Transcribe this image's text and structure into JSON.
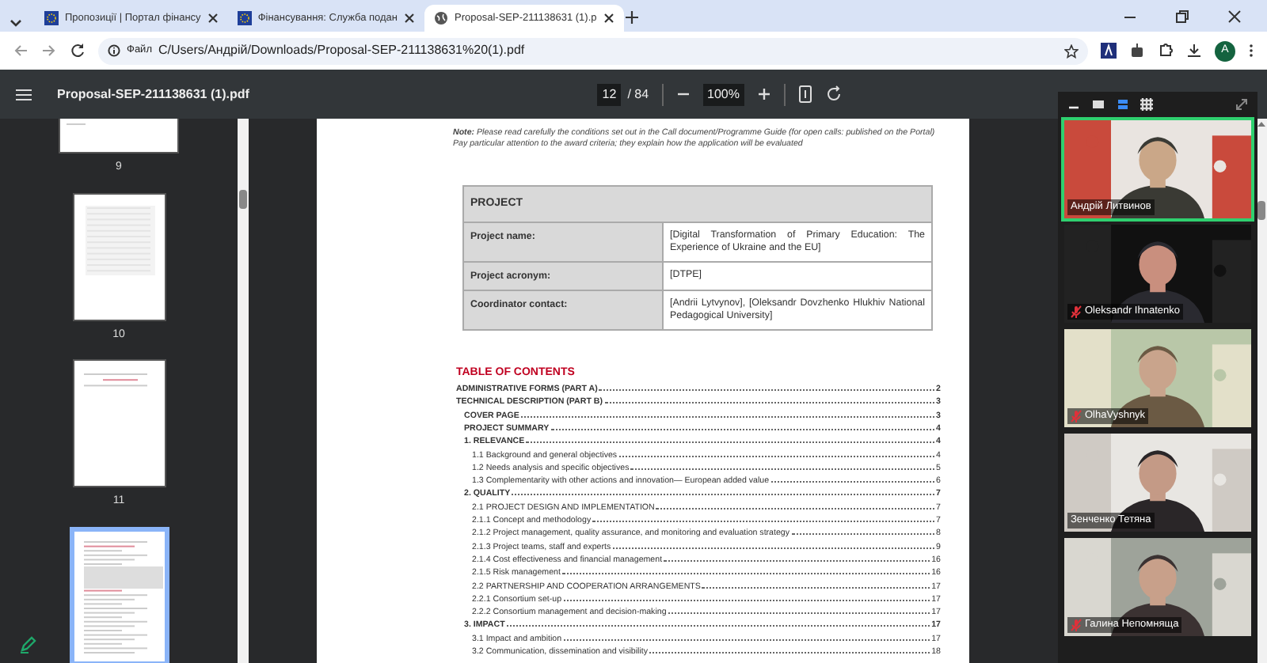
{
  "browser": {
    "tabs": [
      {
        "title": "Пропозиції | Портал фінансу",
        "kind": "eu",
        "selected": false
      },
      {
        "title": "Фінансування: Служба подан",
        "kind": "eu",
        "selected": false
      },
      {
        "title": "Proposal-SEP-211138631 (1).p",
        "kind": "globe",
        "selected": true
      }
    ],
    "address": {
      "chip": "Файл",
      "url": "C/Users/Андрій/Downloads/Proposal-SEP-211138631%20(1).pdf"
    },
    "profile": "A"
  },
  "pdf_toolbar": {
    "title": "Proposal-SEP-211138631 (1).pdf",
    "page": "12",
    "total": "/ 84",
    "zoom": "100%"
  },
  "thumbnails": [
    {
      "label": "9",
      "kind": "partial",
      "selected": false
    },
    {
      "label": "10",
      "kind": "table",
      "selected": false
    },
    {
      "label": "11",
      "kind": "heading",
      "selected": false
    },
    {
      "kind": "toc",
      "selected": true
    }
  ],
  "document": {
    "note": "**Note:** Please read carefully the conditions set out in the Call document/Programme Guide (for open calls: published on the Portal) Pay particular attention to the award criteria; they explain how the application will be evaluated",
    "project_table": {
      "header": "PROJECT",
      "rows": [
        {
          "label": "Project name:",
          "value": "[Digital Transformation of Primary Education: The Experience of Ukraine and the EU]"
        },
        {
          "label": "Project acronym:",
          "value": "[DTPE]"
        },
        {
          "label": "Coordinator contact:",
          "value": "[Andrii Lytvynov], [Oleksandr Dovzhenko Hlukhiv National Pedagogical University]"
        }
      ]
    },
    "toc_title": "TABLE OF CONTENTS",
    "toc": [
      {
        "title": "ADMINISTRATIVE FORMS (PART A)",
        "page": "2"
      },
      {
        "title": "TECHNICAL DESCRIPTION (PART B)",
        "page": "3",
        "children": [
          {
            "title": "COVER PAGE",
            "page": "3"
          },
          {
            "title": "PROJECT SUMMARY",
            "page": "4"
          },
          {
            "title": "1. RELEVANCE",
            "page": "4",
            "children": [
              {
                "title": "1.1 Background and general objectives",
                "page": "4"
              },
              {
                "title": "1.2 Needs analysis and specific objectives",
                "page": "5"
              },
              {
                "title": "1.3 Complementarity with other actions and innovation— European added value",
                "page": "6"
              }
            ]
          },
          {
            "title": "2. QUALITY",
            "page": "7",
            "children": [
              {
                "title": "2.1 PROJECT DESIGN AND IMPLEMENTATION",
                "page": "7"
              },
              {
                "title": "2.1.1 Concept and methodology",
                "page": "7"
              },
              {
                "title": "2.1.2 Project management, quality assurance, and monitoring and evaluation strategy",
                "page": "8"
              },
              {
                "title": "2.1.3 Project teams, staff and experts",
                "page": "9"
              },
              {
                "title": "2.1.4 Cost effectiveness and financial management",
                "page": "16"
              },
              {
                "title": "2.1.5 Risk management",
                "page": "16"
              },
              {
                "title": "2.2 PARTNERSHIP AND COOPERATION ARRANGEMENTS",
                "page": "17"
              },
              {
                "title": "2.2.1 Consortium set-up",
                "page": "17"
              },
              {
                "title": "2.2.2 Consortium management and decision-making",
                "page": "17"
              }
            ]
          },
          {
            "title": "3. IMPACT",
            "page": "17",
            "children": [
              {
                "title": "3.1 Impact and ambition",
                "page": "17"
              },
              {
                "title": "3.2 Communication, dissemination and visibility",
                "page": "18"
              }
            ]
          }
        ]
      }
    ]
  },
  "video_panel": {
    "participants": [
      {
        "name": "Андрій Литвинов",
        "active": true,
        "muted": false
      },
      {
        "name": "Oleksandr Ihnatenko",
        "active": false,
        "muted": true
      },
      {
        "name": "OlhaVyshnyk",
        "active": false,
        "muted": true
      },
      {
        "name": "Зенченко Тетяна",
        "active": false,
        "muted": false
      },
      {
        "name": "Галина Непомняща",
        "active": false,
        "muted": true
      }
    ]
  }
}
